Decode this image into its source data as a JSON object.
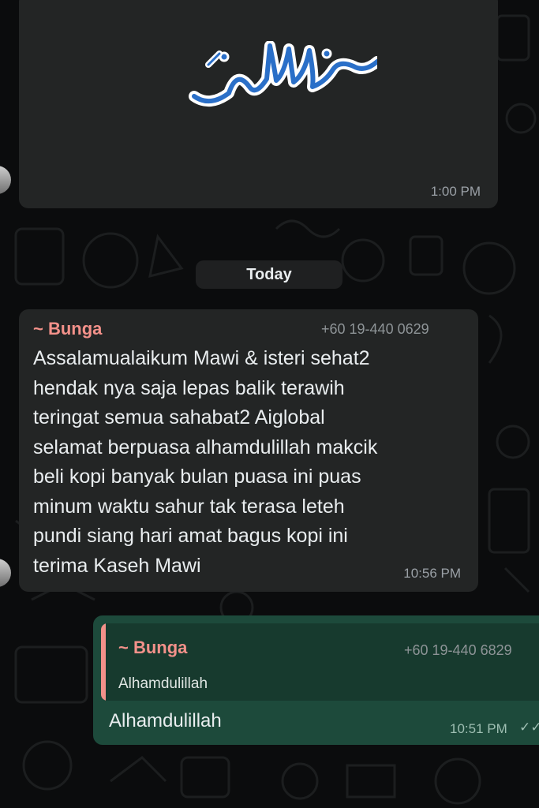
{
  "previous_message": {
    "time": "1:00 PM"
  },
  "date_divider": "Today",
  "incoming_message": {
    "sender_name": "~ Bunga",
    "sender_phone": "+60 19-440 0629",
    "lines": [
      "Assalamualaikum Mawi & isteri sehat2",
      "hendak nya saja lepas balik terawih",
      "teringat semua sahabat2 Aiglobal",
      "selamat berpuasa  alhamdulillah makcik",
      "beli kopi banyak bulan puasa ini puas",
      "minum waktu sahur  tak terasa leteh",
      "pundi siang hari amat bagus kopi ini",
      "terima Kaseh Mawi"
    ],
    "time": "10:56 PM"
  },
  "outgoing_message": {
    "quoted": {
      "sender_name": "~ Bunga",
      "sender_phone": "+60 19-440 6829",
      "text": "Alhamdulillah"
    },
    "text": "Alhamdulillah",
    "time": "10:51 PM"
  }
}
